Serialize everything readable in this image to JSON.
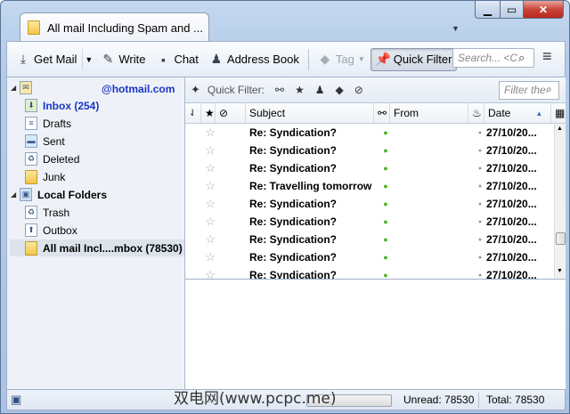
{
  "window": {
    "tab_title": "All mail Including Spam and ...",
    "tabs_dropdown_icon": "chevron-down-icon",
    "controls": {
      "minimize_icon": "minimize-icon",
      "maximize_icon": "maximize-icon",
      "close_icon": "close-icon"
    }
  },
  "toolbar": {
    "get_mail": "Get Mail",
    "write": "Write",
    "chat": "Chat",
    "address_book": "Address Book",
    "tag": "Tag",
    "quick_filter": "Quick Filter",
    "search_placeholder": "Search... <C"
  },
  "folders": {
    "account": "@hotmail.com",
    "items": [
      {
        "label": "Inbox (254)",
        "icon": "inbox-icon"
      },
      {
        "label": "Drafts",
        "icon": "drafts-icon"
      },
      {
        "label": "Sent",
        "icon": "sent-icon"
      },
      {
        "label": "Deleted",
        "icon": "deleted-icon"
      },
      {
        "label": "Junk",
        "icon": "folder-icon"
      }
    ],
    "local_folders": "Local Folders",
    "local_items": [
      {
        "label": "Trash",
        "icon": "trash-icon"
      },
      {
        "label": "Outbox",
        "icon": "outbox-icon"
      },
      {
        "label": "All mail Incl....mbox (78530)",
        "icon": "folder-icon"
      }
    ]
  },
  "quick_filter": {
    "label": "Quick Filter:",
    "filter_placeholder": "Filter the"
  },
  "columns": {
    "subject": "Subject",
    "from": "From",
    "date": "Date"
  },
  "messages": [
    {
      "subject": "Re: Syndication?",
      "date": "27/10/20..."
    },
    {
      "subject": "Re: Syndication?",
      "date": "27/10/20..."
    },
    {
      "subject": "Re: Syndication?",
      "date": "27/10/20..."
    },
    {
      "subject": "Re: Travelling tomorrow",
      "date": "27/10/20..."
    },
    {
      "subject": "Re: Syndication?",
      "date": "27/10/20..."
    },
    {
      "subject": "Re: Syndication?",
      "date": "27/10/20..."
    },
    {
      "subject": "Re: Syndication?",
      "date": "27/10/20..."
    },
    {
      "subject": "Re: Syndication?",
      "date": "27/10/20..."
    },
    {
      "subject": "Re: Syndication?",
      "date": "27/10/20..."
    }
  ],
  "status": {
    "unread": "Unread: 78530",
    "total": "Total: 78530",
    "watermark": "双电网(www.pcpc.me)"
  },
  "colors": {
    "accent": "#1a35c6",
    "online_dot": "#4db325",
    "close": "#c7453b"
  }
}
